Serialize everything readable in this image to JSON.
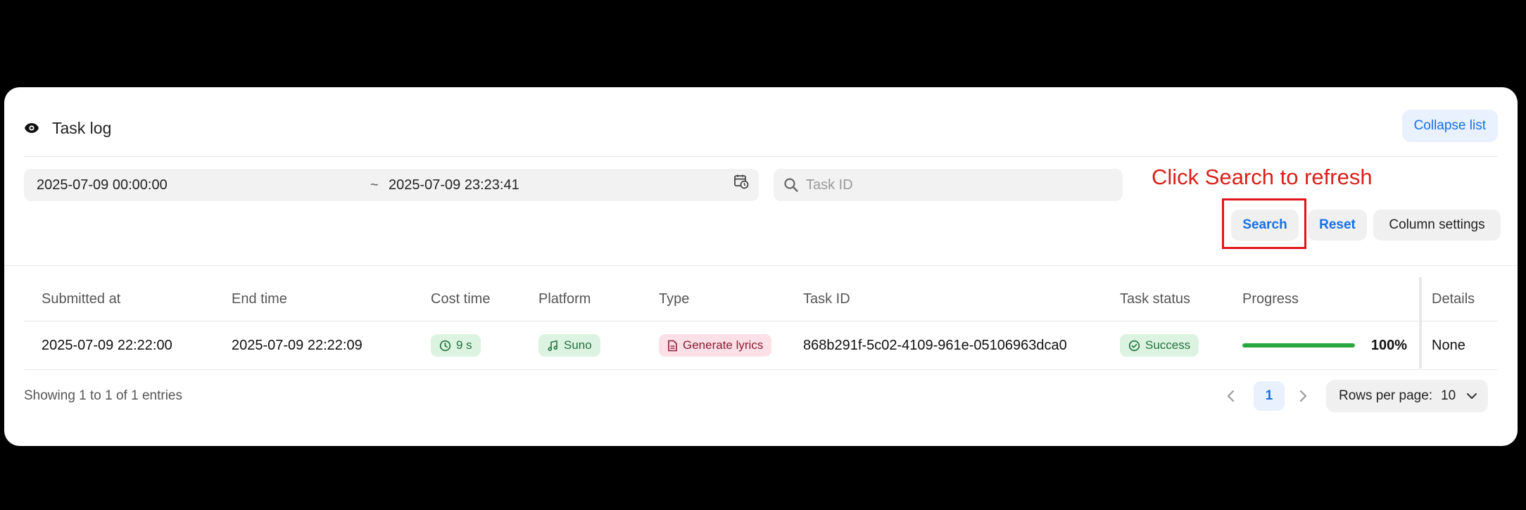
{
  "header": {
    "title": "Task log",
    "collapse_label": "Collapse list"
  },
  "filters": {
    "date_start": "2025-07-09 00:00:00",
    "date_separator": "~",
    "date_end": "2025-07-09 23:23:41",
    "task_id_placeholder": "Task ID",
    "task_id_value": "",
    "search_label": "Search",
    "reset_label": "Reset",
    "column_settings_label": "Column settings"
  },
  "annotation": {
    "text": "Click Search to refresh",
    "color": "#d9201c"
  },
  "table": {
    "columns": [
      "Submitted at",
      "End time",
      "Cost time",
      "Platform",
      "Type",
      "Task ID",
      "Task status",
      "Progress",
      "Details"
    ],
    "rows": [
      {
        "submitted_at": "2025-07-09 22:22:00",
        "end_time": "2025-07-09 22:22:09",
        "cost_time": "9 s",
        "platform": "Suno",
        "type": "Generate lyrics",
        "task_id": "868b291f-5c02-4109-961e-05106963dca0",
        "status": "Success",
        "progress_fraction": 1.0,
        "progress_label": "100%",
        "details": "None"
      }
    ]
  },
  "footer": {
    "showing": "Showing 1 to 1 of 1 entries",
    "current_page": "1",
    "rows_per_page_label": "Rows per page:",
    "rows_per_page_value": "10"
  },
  "icons": {
    "title": "eye-icon",
    "calendar": "calendar-clock-icon",
    "search": "search-icon",
    "cost_time": "clock-icon",
    "platform": "music-note-icon",
    "type": "document-icon",
    "status": "check-circle-icon",
    "prev": "chevron-left-icon",
    "next": "chevron-right-icon",
    "dropdown": "chevron-down-icon"
  },
  "colors": {
    "accent": "#1670e5",
    "success_bg": "#ddf3e2",
    "success_text": "#23733c",
    "lyrics_bg": "#fbe1e7",
    "lyrics_text": "#8a1b33",
    "progress_fill": "#2aa63e"
  }
}
